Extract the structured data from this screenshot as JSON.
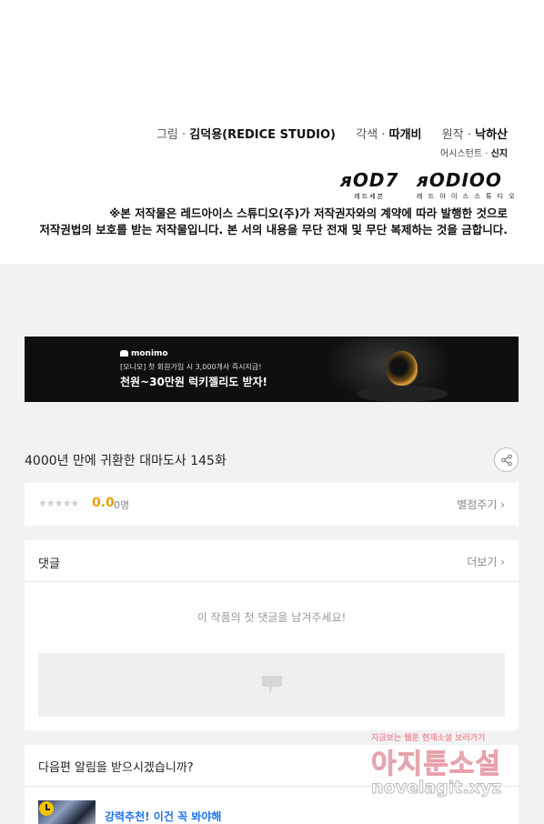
{
  "credits": {
    "art_label": "그림 · ",
    "art_value": "김덕용(REDICE STUDIO)",
    "adapt_label": "각색 · ",
    "adapt_value": "따개비",
    "original_label": "원작 · ",
    "original_value": "낙하산",
    "assistant_label": "어시스턴트 · ",
    "assistant_value": "신지",
    "logo1_big": "ᴙOD7",
    "logo1_small": "레드세븐",
    "logo2_big": "ᴙODIOO",
    "logo2_small": "레 드 아 이 스  스 튜 디 오",
    "notice_line1": "※본 저작물은 레드아이스 스튜디오(주)가 저작권자와의 계약에 따라 발행한 것으로",
    "notice_line2": "저작권법의 보호를 받는 저작물입니다. 본 서의 내용을 무단 전재 및 무단 복제하는 것을 금합니다."
  },
  "banner": {
    "brand": "monimo",
    "sub": "[모니모] 첫 회원가입 시 3,000개사 즉시지급!",
    "main": "천원~30만원 럭키젤리도 받자!"
  },
  "episode": {
    "title": "4000년 만에 귀환한 대마도사 145화",
    "share_icon": "share-icon"
  },
  "rating": {
    "stars": "★★★★★",
    "value": "0.0",
    "count": "0명",
    "rate_link": "별점주기 ›"
  },
  "comments": {
    "title": "댓글",
    "more": "더보기 ›",
    "empty_text": "이 작품의 첫 댓글을 남겨주세요!"
  },
  "notify": {
    "title": "다음편 알림을 받으시겠습니까?",
    "recommend": "강력추천! 이건 꼭 봐야해"
  },
  "watermark": {
    "small": "지금보는 웹툰 현재소설 보러가기",
    "big": "아지툰소설",
    "url": "novelagit.xyz"
  },
  "colors": {
    "accent_blue": "#1e72e8",
    "rating_orange": "#e8a000",
    "banner_bg": "#0f0f0f"
  }
}
